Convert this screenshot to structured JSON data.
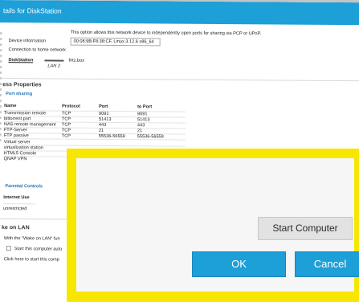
{
  "window": {
    "title": "tails for DiskStation"
  },
  "intro": {
    "text": "This option allows this network device to independently open ports for sharing via PCP or UPnP."
  },
  "device_info": {
    "label": "Device information",
    "value": "00:08:9B:F8:38:CF, Linux 3.12.6 x86_64"
  },
  "connection": {
    "label": "Connection to home network",
    "device": "DiskStation",
    "link": "LAN 2",
    "router": "fritz.box"
  },
  "access": {
    "title": "ess Properties"
  },
  "port_sharing": {
    "title": "Port sharing",
    "headers": [
      "Name",
      "Protocol",
      "Port",
      "to Port"
    ],
    "rows": [
      [
        "Transmission remote",
        "TCP",
        "9091",
        "9091"
      ],
      [
        "bittorrent port",
        "TCP",
        "51413",
        "51413"
      ],
      [
        "NAS remote management",
        "TCP",
        "443",
        "443"
      ],
      [
        "FTP-Server",
        "TCP",
        "21",
        "21"
      ],
      [
        "FTP passive",
        "TCP",
        "55536-56559",
        "55536-56559"
      ],
      [
        "Virtual server",
        "",
        "",
        ""
      ],
      [
        "virtualization station",
        "",
        "",
        ""
      ],
      [
        "HTML5 Console",
        "",
        "",
        ""
      ],
      [
        "QNAP VPN",
        "",
        "",
        ""
      ]
    ]
  },
  "parental": {
    "title": "Parental Controls",
    "col": "Internet Use",
    "value": "unrestricted"
  },
  "wol": {
    "title": "ke on LAN",
    "text": "With the \"Wake on LAN\" fun",
    "checkbox_label": "Start this computer auto",
    "click_text": "Click here to start this comp"
  },
  "dialog": {
    "start_label": "Start Computer",
    "ok_label": "OK",
    "cancel_label": "Cancel"
  },
  "colors": {
    "header": "#1d9fd8",
    "highlight": "#f6e600",
    "button": "#1d9fd8"
  }
}
